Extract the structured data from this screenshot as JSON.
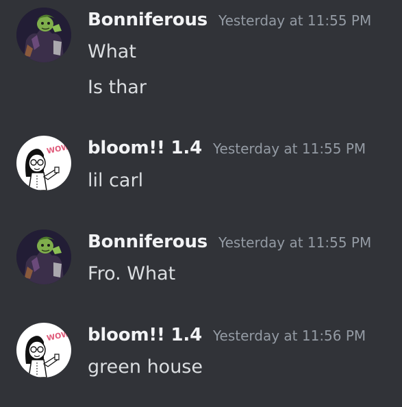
{
  "messages": [
    {
      "author": "Bonniferous",
      "timestamp": "Yesterday at 11:55 PM",
      "avatar_icon": "green-zombie-avatar",
      "lines": [
        "What",
        "Is thar"
      ]
    },
    {
      "author": "bloom!! 1.4",
      "timestamp": "Yesterday at 11:55 PM",
      "avatar_icon": "sketch-character-wow-avatar",
      "lines": [
        "lil carl"
      ]
    },
    {
      "author": "Bonniferous",
      "timestamp": "Yesterday at 11:55 PM",
      "avatar_icon": "green-zombie-avatar",
      "lines": [
        "Fro. What"
      ]
    },
    {
      "author": "bloom!! 1.4",
      "timestamp": "Yesterday at 11:56 PM",
      "avatar_icon": "sketch-character-wow-avatar",
      "lines": [
        "green house"
      ]
    }
  ],
  "avatar_wow_text": "WOW!",
  "colors": {
    "background": "#313338",
    "username": "#f2f3f5",
    "timestamp": "#949ba4",
    "message_text": "#dbdee1"
  }
}
